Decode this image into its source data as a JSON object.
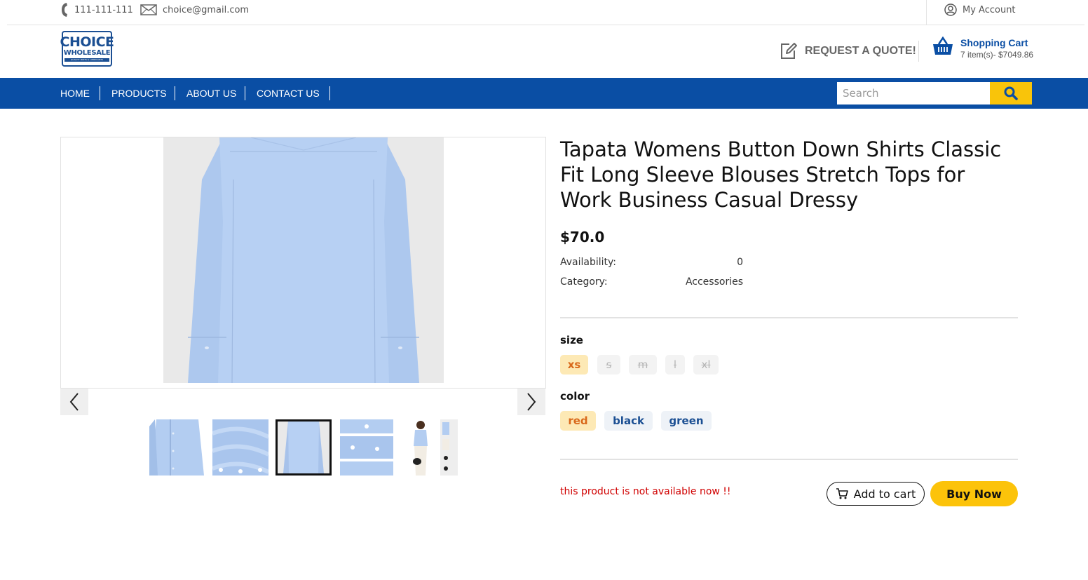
{
  "topbar": {
    "phone": "111-111-111",
    "email": "choice@gmail.com",
    "account": "My Account",
    "icons": {
      "phone": "phone-icon",
      "email": "mail-icon",
      "account": "user-circle-icon"
    }
  },
  "header": {
    "logo_line1": "CHOICE",
    "logo_line2": "WHOLESALE",
    "logo_line3": "QUALITY PARTS & LUBRICANTS",
    "quote_label": "REQUEST A QUOTE!",
    "cart_title": "Shopping Cart",
    "cart_summary": "7 item(s)- $7049.86",
    "icons": {
      "quote": "edit-icon",
      "cart": "basket-icon"
    }
  },
  "nav": {
    "items": [
      "HOME",
      "PRODUCTS",
      "ABOUT US",
      "CONTACT US"
    ],
    "search_placeholder": "Search",
    "search_icon": "search-icon"
  },
  "colors": {
    "brand_blue": "#0a4ea4",
    "accent_yellow": "#fcc30a",
    "error_red": "#d00000",
    "selected_chip_bg": "#fde9b5",
    "selected_chip_text": "#d9691b"
  },
  "gallery": {
    "thumb_count": 5,
    "active_thumb_index": 2,
    "icons": {
      "prev": "chevron-left-icon",
      "next": "chevron-right-icon"
    }
  },
  "product": {
    "title": "Tapata Womens Button Down Shirts Classic Fit Long Sleeve Blouses Stretch Tops for Work Business Casual Dressy",
    "price": "$70.0",
    "availability_label": "Availability:",
    "availability_value": "0",
    "category_label": "Category:",
    "category_value": "Accessories",
    "size_label": "size",
    "sizes": [
      "xs",
      "s",
      "m",
      "l",
      "xl"
    ],
    "selected_size": "xs",
    "color_label": "color",
    "colors": [
      "red",
      "black",
      "green"
    ],
    "selected_color": "red",
    "unavailable_message": "this product is not available now !!",
    "add_to_cart_label": "Add to cart",
    "buy_now_label": "Buy Now"
  }
}
